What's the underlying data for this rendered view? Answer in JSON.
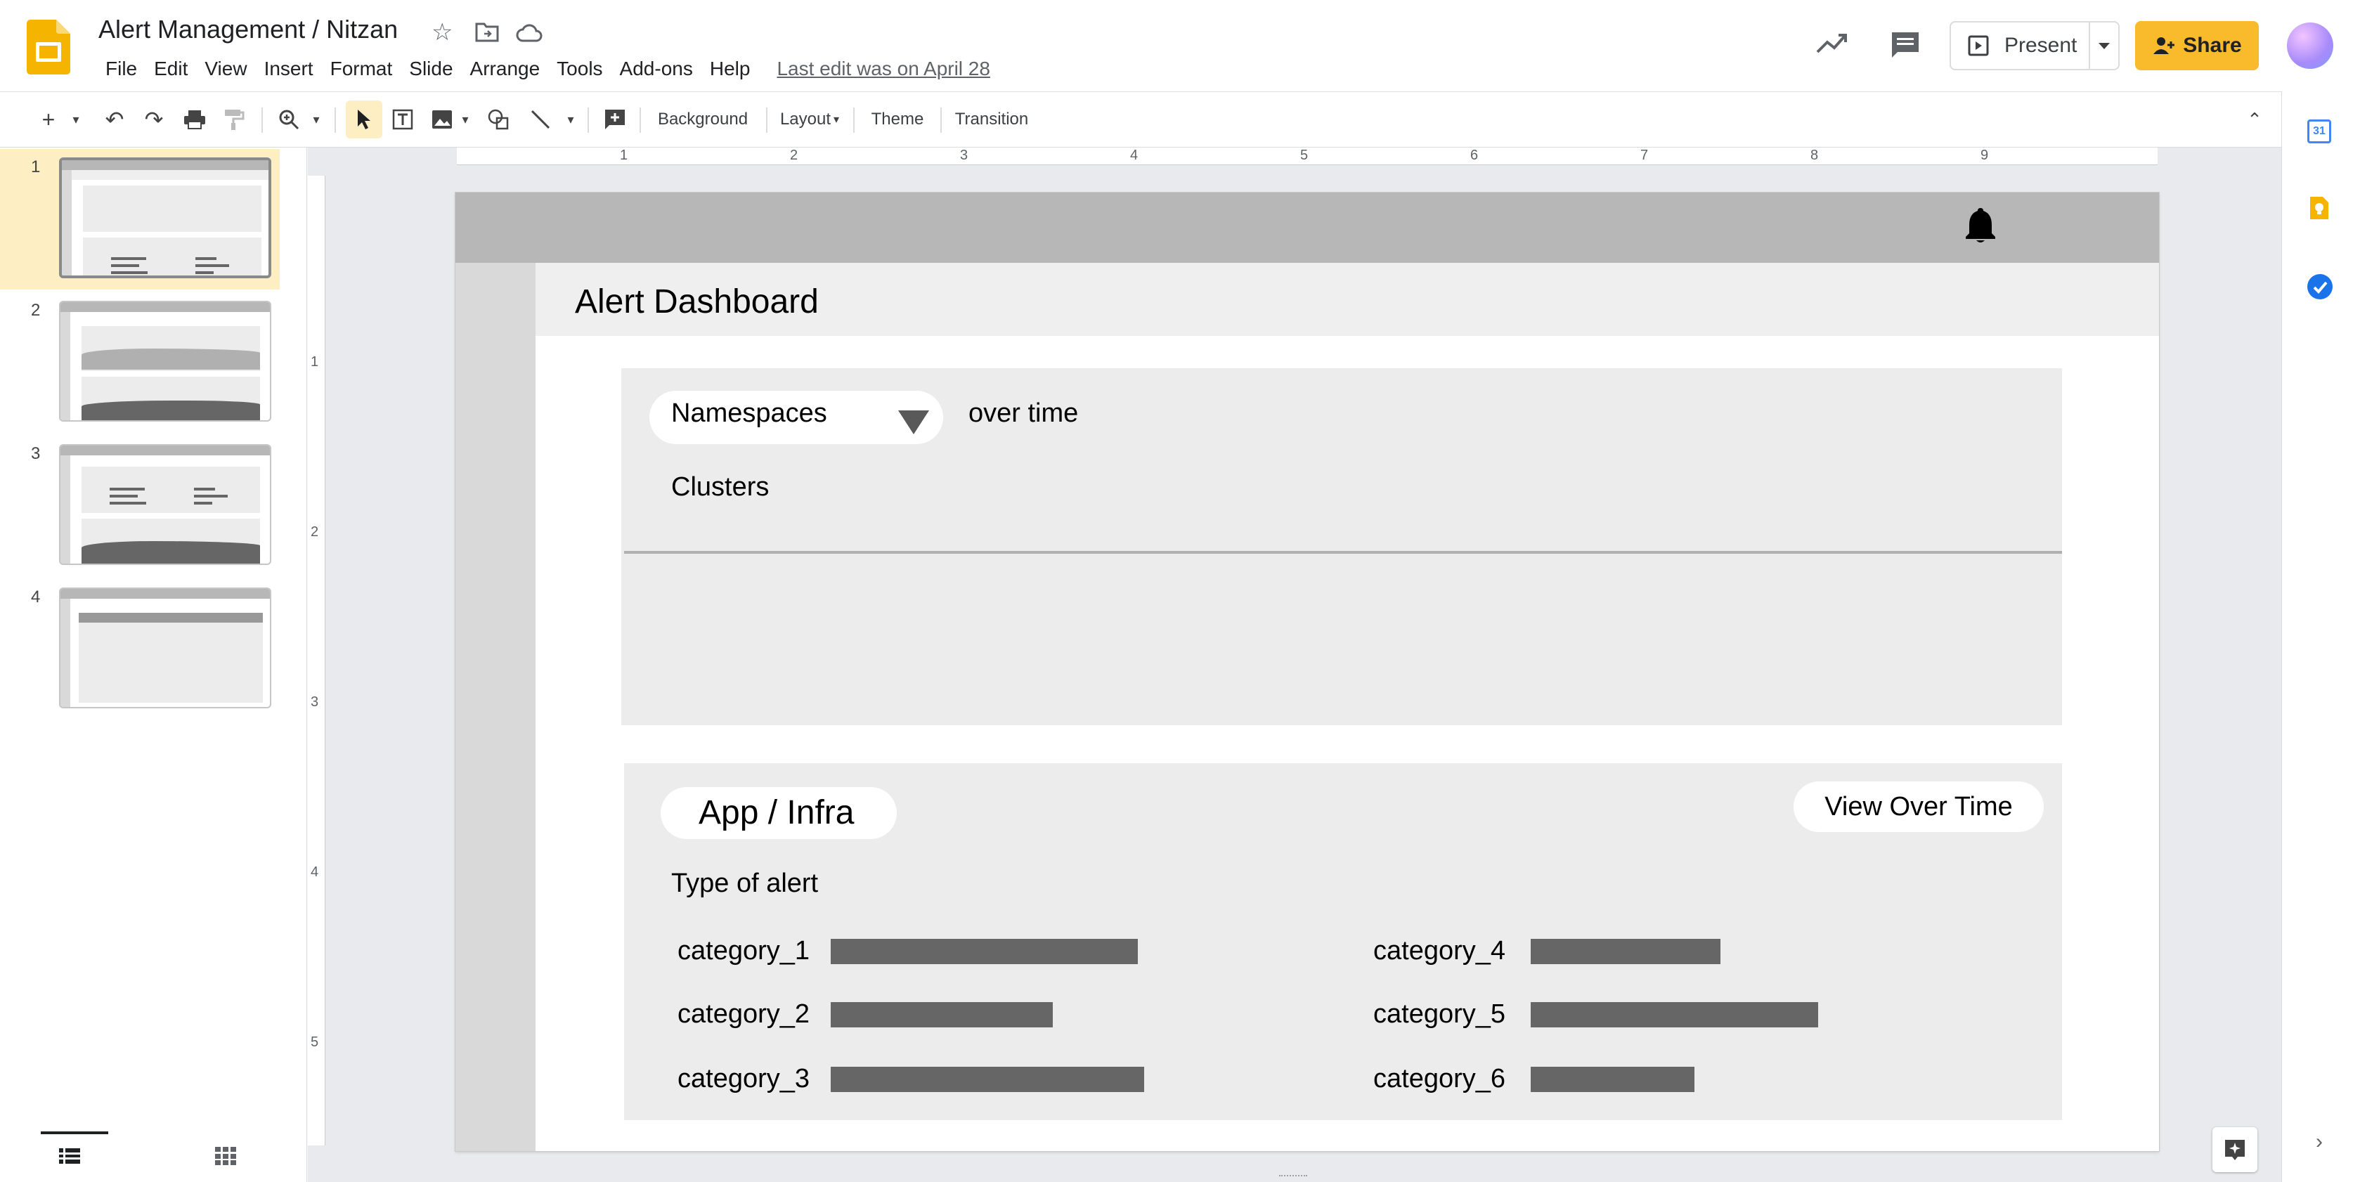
{
  "app": {
    "doc_title": "Alert Management / Nitzan",
    "menu": [
      "File",
      "Edit",
      "View",
      "Insert",
      "Format",
      "Slide",
      "Arrange",
      "Tools",
      "Add-ons",
      "Help"
    ],
    "last_edit": "Last edit was on April 28",
    "present_label": "Present",
    "share_label": "Share",
    "accent_color": "#f9bb2c"
  },
  "toolbar": {
    "background_label": "Background",
    "layout_label": "Layout",
    "theme_label": "Theme",
    "transition_label": "Transition"
  },
  "filmstrip": {
    "slides": [
      "1",
      "2",
      "3",
      "4"
    ],
    "selected": "1"
  },
  "ruler": {
    "horizontal": [
      "1",
      "2",
      "3",
      "4",
      "5",
      "6",
      "7",
      "8",
      "9"
    ],
    "vertical": [
      "1",
      "2",
      "3",
      "4",
      "5"
    ]
  },
  "slide": {
    "title": "Alert Dashboard",
    "panel1": {
      "namespace_select": "Namespaces",
      "over_time": "over time",
      "clusters": "Clusters"
    },
    "panel2": {
      "scope": "App / Infra",
      "view_over_time": "View Over Time",
      "type_of_alert": "Type of alert",
      "categories": [
        {
          "name": "category_1",
          "level": 0.47
        },
        {
          "name": "category_2",
          "level": 0.34
        },
        {
          "name": "category_3",
          "level": 0.48
        },
        {
          "name": "category_4",
          "level": 0.29
        },
        {
          "name": "category_5",
          "level": 0.44
        },
        {
          "name": "category_6",
          "level": 0.25
        }
      ]
    }
  }
}
